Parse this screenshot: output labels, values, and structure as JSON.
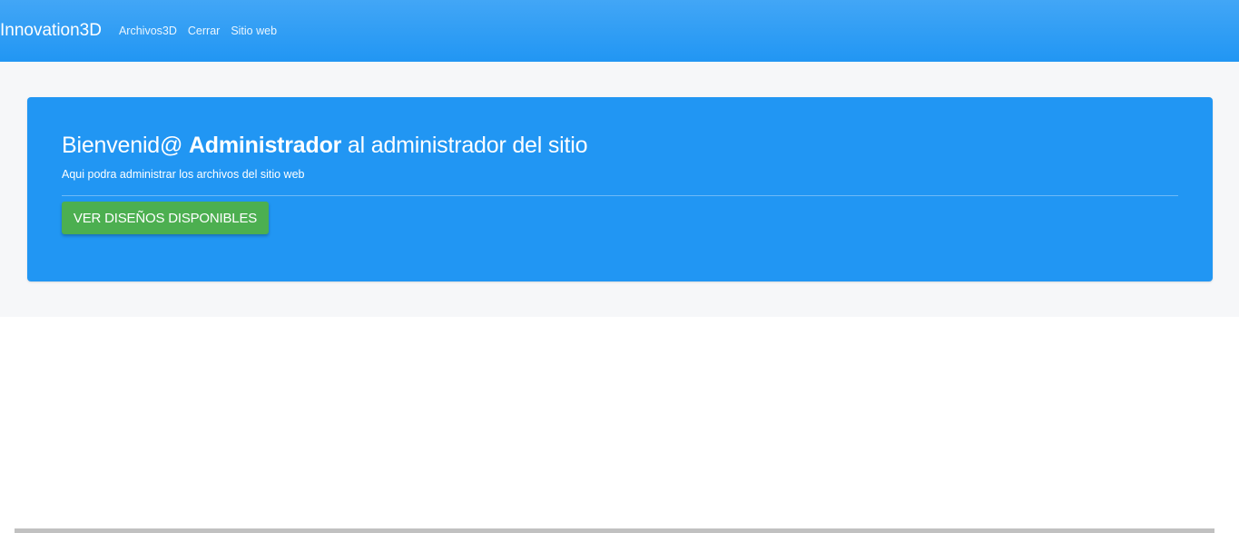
{
  "navbar": {
    "brand": "Innovation3D",
    "links": [
      "Archivos3D",
      "Cerrar",
      "Sitio web"
    ]
  },
  "jumbotron": {
    "title_prefix": "Bienvenid@ ",
    "title_user": "Administrador",
    "title_suffix": " al administrador del sitio",
    "subtitle": "Aqui podra administrar los archivos del sitio web",
    "button_label": "VER DISEÑOS DISPONIBLES"
  },
  "colors": {
    "navbar": "#2196f3",
    "jumbotron": "#2196f3",
    "button": "#4caf50",
    "page_background": "#f6f7f9"
  }
}
